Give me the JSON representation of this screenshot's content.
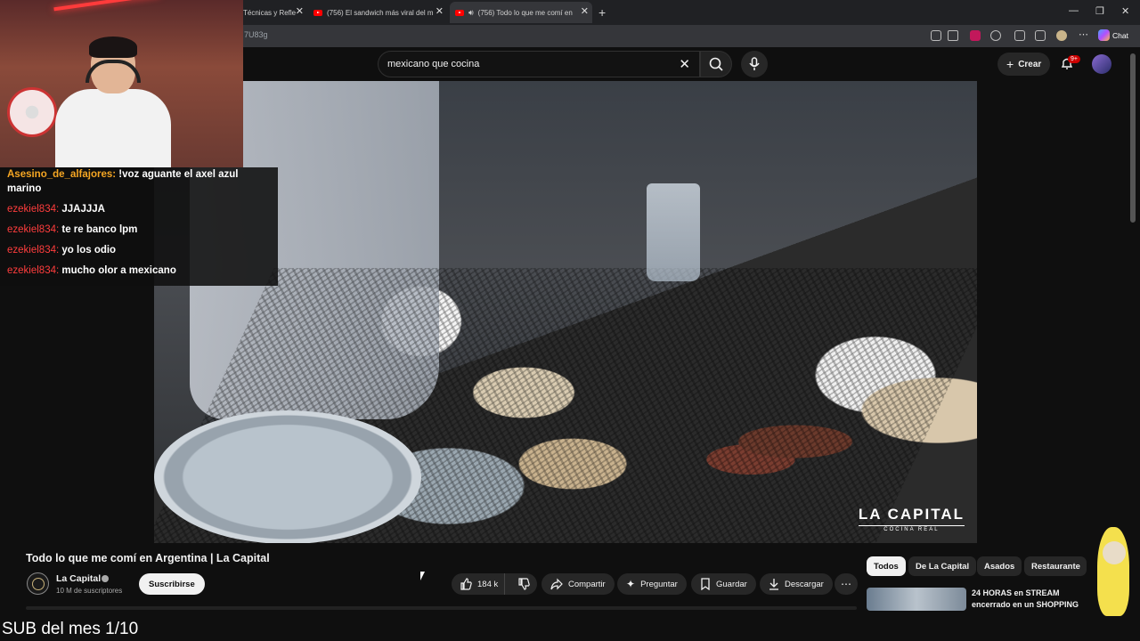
{
  "browser": {
    "tabs": [
      {
        "label": "Técnicas y Refle"
      },
      {
        "label": "(756) El sandwich más viral del mu"
      },
      {
        "label": "(756) Todo lo que me comí en"
      }
    ],
    "new_tab": "+",
    "url": "7U83g",
    "copilot_label": "Chat"
  },
  "youtube": {
    "search": {
      "value": "mexicano que cocina"
    },
    "create_label": "Crear",
    "notifications_badge": "9+"
  },
  "video": {
    "watermark_brand": "LA CAPITAL",
    "watermark_sub": "COCINA REAL",
    "title": "Todo lo que me comí en Argentina | La Capital",
    "channel": {
      "name": "La Capital",
      "subscribers": "10 M de suscriptores",
      "subscribe_label": "Suscribirse"
    },
    "actions": {
      "likes": "184 k",
      "share": "Compartir",
      "ask": "Preguntar",
      "save": "Guardar",
      "download": "Descargar",
      "more": "⋯"
    }
  },
  "chat": [
    {
      "user": "Asesino_de_alfajores:",
      "msg": "!voz aguante el axel azul marino",
      "user_color": "#f5a623"
    },
    {
      "user": "ezekiel834:",
      "msg": "JJAJJJA",
      "user_color": "#ff3d3d"
    },
    {
      "user": "ezekiel834:",
      "msg": "te re banco lpm",
      "user_color": "#ff3d3d"
    },
    {
      "user": "ezekiel834:",
      "msg": "yo los odio",
      "user_color": "#ff3d3d"
    },
    {
      "user": "ezekiel834:",
      "msg": "mucho olor a mexicano",
      "user_color": "#ff3d3d"
    }
  ],
  "recommendations": {
    "chips": [
      "Todos",
      "De La Capital",
      "Asados",
      "Restaurante"
    ],
    "first_video_title": "24 HORAS en STREAM encerrado en un SHOPPING"
  },
  "stream_banner": "SUB del mes 1/10",
  "icons": [
    "x-icon",
    "search-icon",
    "mic-icon",
    "plus-icon",
    "bell-icon",
    "thumbs-up-icon",
    "thumbs-down-icon",
    "share-icon",
    "sparkle-icon",
    "bookmark-icon",
    "download-icon"
  ]
}
